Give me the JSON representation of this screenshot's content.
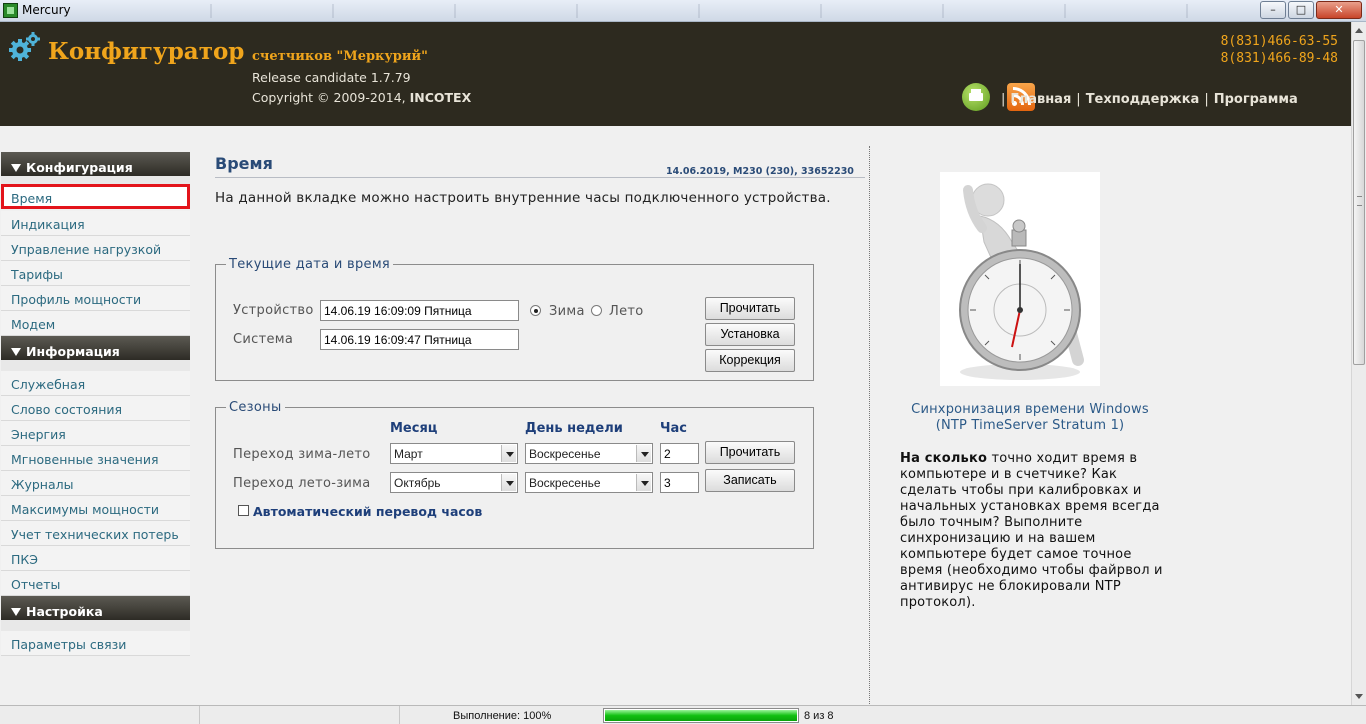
{
  "window": {
    "title": "Mercury",
    "min_label": "–",
    "max_label": "□",
    "close_label": "✕"
  },
  "header": {
    "brand": "Конфигуратор",
    "brand_sub": "счетчиков \"Меркурий\"",
    "release": "Release candidate 1.7.79",
    "copyright_prefix": "Copyright © 2009-2014, ",
    "copyright_company": "INCOTEX",
    "phones": [
      "8(831)466-63-55",
      "8(831)466-89-48"
    ],
    "nav": {
      "separator": "|",
      "home": "Главная",
      "support": "Техподдержка",
      "program": "Программа"
    }
  },
  "sidebar": {
    "sections": [
      {
        "title": "Конфигурация",
        "items": [
          "Время",
          "Индикация",
          "Управление нагрузкой",
          "Тарифы",
          "Профиль мощности",
          "Модем"
        ]
      },
      {
        "title": "Информация",
        "items": [
          "Служебная",
          "Слово состояния",
          "Энергия",
          "Мгновенные значения",
          "Журналы",
          "Максимумы мощности",
          "Учет технических потерь",
          "ПКЭ",
          "Отчеты"
        ]
      },
      {
        "title": "Настройка",
        "items": [
          "Параметры связи"
        ]
      }
    ],
    "active_item": "Время"
  },
  "main": {
    "title": "Время",
    "meta": "14.06.2019, M230 (230), 33652230",
    "intro": "На данной вкладке можно настроить внутренние часы подключенного устройства.",
    "current": {
      "legend": "Текущие дата и время",
      "device_label": "Устройство",
      "device_value": "14.06.19  16:09:09  Пятница",
      "system_label": "Система",
      "system_value": "14.06.19  16:09:47  Пятница",
      "winter_label": "Зима",
      "summer_label": "Лето",
      "selected_season": "winter",
      "read_button": "Прочитать",
      "set_button": "Установка",
      "correct_button": "Коррекция"
    },
    "seasons": {
      "legend": "Сезоны",
      "col_month": "Месяц",
      "col_weekday": "День недели",
      "col_hour": "Час",
      "rows": [
        {
          "label": "Переход зима-лето",
          "month": "Март",
          "weekday": "Воскресенье",
          "hour": "2"
        },
        {
          "label": "Переход лето-зима",
          "month": "Октябрь",
          "weekday": "Воскресенье",
          "hour": "3"
        }
      ],
      "read_button": "Прочитать",
      "write_button": "Записать",
      "auto_label": "Автоматический перевод часов",
      "auto_checked": false
    }
  },
  "right": {
    "link_line1": "Синхронизация времени Windows",
    "link_line2": "(NTP TimeServer Stratum 1)",
    "text_bold": "На сколько",
    "text_rest": " точно ходит время в компьютере и в счетчике? Как сделать чтобы при калибровках и начальных установках время всегда было точным? Выполните синхронизацию и на вашем компьютере будет самое точное время (необходимо чтобы файрвол и антивирус не блокировали NTP протокол)."
  },
  "status": {
    "label": "Выполнение: 100%",
    "progress_fraction": 1.0,
    "count": "8 из 8"
  },
  "colors": {
    "accent": "#f0a51c",
    "header_bg": "#2d2a1f",
    "link": "#2c6a80",
    "title": "#2a4b77",
    "active_outline": "#e3141b",
    "progress": "#12c012"
  }
}
